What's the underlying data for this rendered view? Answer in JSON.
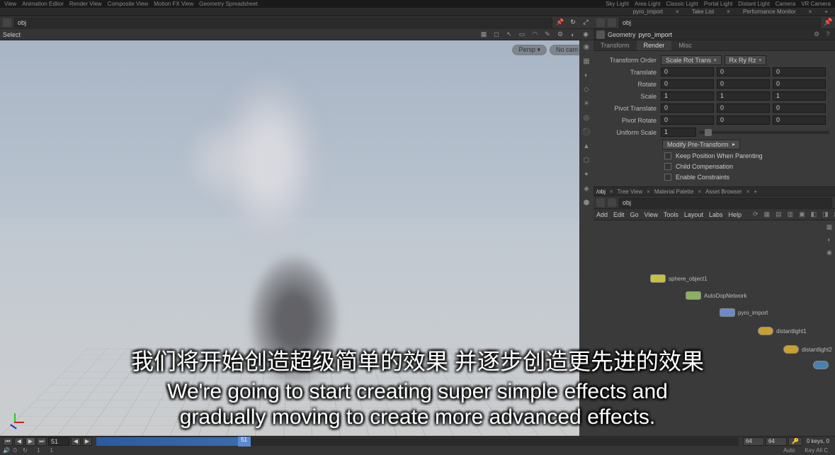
{
  "top1": {
    "items_left": [
      "View",
      "Animation Editor",
      "Render View",
      "Composite View",
      "Motion FX View",
      "Geometry Spreadsheet"
    ],
    "items_right": [
      "Sky Light",
      "Area Light",
      "Classic Light",
      "Portal Light",
      "Distant Light",
      "Camera",
      "VR Camera"
    ]
  },
  "top2": {
    "tabs": [
      "pyro_import",
      "Take List",
      "Performance Monitor"
    ]
  },
  "path": {
    "obj": "obj"
  },
  "select_label": "Select",
  "hud": {
    "persp": "Persp ▾",
    "cam": "No cam ▾"
  },
  "geo": {
    "type": "Geometry",
    "name": "pyro_import"
  },
  "subtabs": [
    "Transform",
    "Render",
    "Misc"
  ],
  "params": {
    "transform_order": {
      "lbl": "Transform Order",
      "dd1": "Scale Rot Trans",
      "dd2": "Rx Ry Rz"
    },
    "translate": {
      "lbl": "Translate",
      "x": "0",
      "y": "0",
      "z": "0"
    },
    "rotate": {
      "lbl": "Rotate",
      "x": "0",
      "y": "0",
      "z": "0"
    },
    "scale": {
      "lbl": "Scale",
      "x": "1",
      "y": "1",
      "z": "1"
    },
    "pivot_translate": {
      "lbl": "Pivot Translate",
      "x": "0",
      "y": "0",
      "z": "0"
    },
    "pivot_rotate": {
      "lbl": "Pivot Rotate",
      "x": "0",
      "y": "0",
      "z": "0"
    },
    "uniform_scale": {
      "lbl": "Uniform Scale",
      "v": "1"
    },
    "modify": "Modify Pre-Transform",
    "chk1": "Keep Position When Parenting",
    "chk2": "Child Compensation",
    "chk3": "Enable Constraints"
  },
  "nettabs": {
    "path": "/obj",
    "t1": "Tree View",
    "t2": "Material Palette",
    "t3": "Asset Browser"
  },
  "netpath": "obj",
  "netmenu": [
    "Add",
    "Edit",
    "Go",
    "View",
    "Tools",
    "Layout",
    "Labs",
    "Help"
  ],
  "nodes": {
    "n1": "sphere_object1",
    "n2": "AutoDopNetwork",
    "n3": "pyro_import",
    "n4": "distantlight1",
    "n5": "distantlight2"
  },
  "timeline": {
    "frame": "51",
    "head": "51",
    "range_end": "64",
    "range_end2": "64",
    "one": "1",
    "one2": "1",
    "auto": "Auto",
    "status": "0 keys, 0",
    "keyall": "Key All C"
  },
  "subtitle": {
    "cn": "我们将开始创造超级简单的效果 并逐步创造更先进的效果",
    "en1": "We're going to start creating super simple effects and",
    "en2": "gradually moving to create more advanced effects."
  }
}
